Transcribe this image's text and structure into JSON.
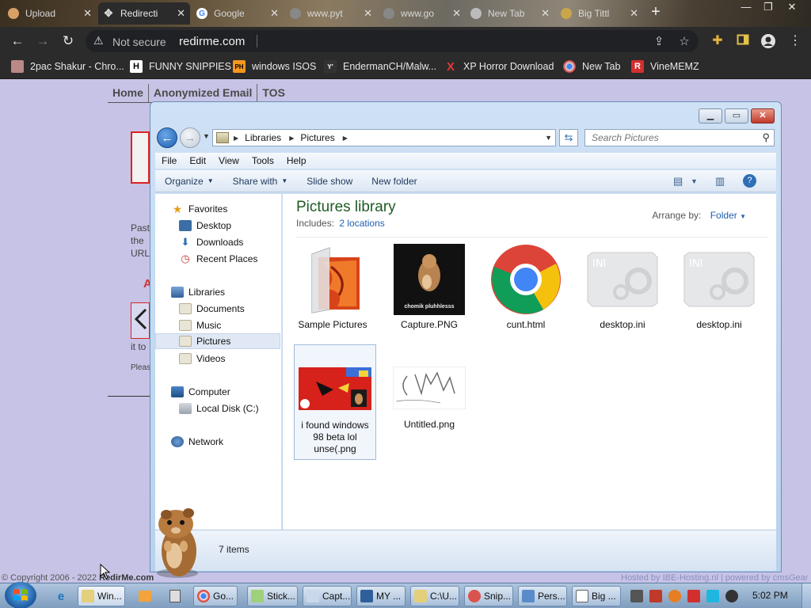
{
  "browser": {
    "tabs": [
      {
        "label": "Upload",
        "icon": "upload-tab-icon",
        "active": false
      },
      {
        "label": "Redirecti",
        "icon": "redirect-icon",
        "active": true
      },
      {
        "label": "Google",
        "icon": "google-icon",
        "active": false
      },
      {
        "label": "www.pyt",
        "icon": "globe-icon",
        "active": false
      },
      {
        "label": "www.go",
        "icon": "globe-icon",
        "active": false
      },
      {
        "label": "New Tab",
        "icon": "chrome-icon",
        "active": false
      },
      {
        "label": "Big Tittl",
        "icon": "page-icon",
        "active": false
      }
    ],
    "security_label": "Not secure",
    "url": "redirme.com",
    "bookmarks": [
      {
        "label": "2pac Shakur - Chro...",
        "icon": "bookmark-2pac-icon"
      },
      {
        "label": "FUNNY SNIPPIES",
        "icon": "h-icon"
      },
      {
        "label": "windows ISOS",
        "icon": "ph-icon"
      },
      {
        "label": "EndermanCH/Malw...",
        "icon": "yp-icon"
      },
      {
        "label": "XP Horror Download",
        "icon": "x-icon"
      },
      {
        "label": "New Tab",
        "icon": "chrome-icon"
      },
      {
        "label": "VineMEMZ",
        "icon": "r-icon"
      }
    ]
  },
  "webpage": {
    "nav": [
      "Home",
      "Anonymized Email",
      "TOS"
    ],
    "fragments": {
      "past": "Past",
      "the": "the",
      "url": "URL",
      "a": "A",
      "itto": "it to",
      "pleas": "Pleas"
    },
    "copyright_prefix": "© Copyright 2006 - 2022",
    "copyright_site": "RedirMe.com",
    "hosted": "Hosted by IBE-Hosting.nl  |  powered by cmsGear"
  },
  "explorer": {
    "breadcrumbs": [
      "Libraries",
      "Pictures"
    ],
    "search_placeholder": "Search Pictures",
    "menu": [
      "File",
      "Edit",
      "View",
      "Tools",
      "Help"
    ],
    "commands": [
      {
        "label": "Organize",
        "dropdown": true
      },
      {
        "label": "Share with",
        "dropdown": true
      },
      {
        "label": "Slide show",
        "dropdown": false
      },
      {
        "label": "New folder",
        "dropdown": false
      }
    ],
    "nav_pane": {
      "favorites_label": "Favorites",
      "favorites": [
        "Desktop",
        "Downloads",
        "Recent Places"
      ],
      "libraries_label": "Libraries",
      "libraries": [
        "Documents",
        "Music",
        "Pictures",
        "Videos"
      ],
      "selected": "Pictures",
      "computer_label": "Computer",
      "computer": [
        "Local Disk (C:)"
      ],
      "network_label": "Network"
    },
    "library_title": "Pictures library",
    "includes_label": "Includes:",
    "includes_link": "2 locations",
    "arrange_label": "Arrange by:",
    "arrange_value": "Folder",
    "files": [
      {
        "name": "Sample Pictures",
        "type": "folder"
      },
      {
        "name": "Capture.PNG",
        "type": "image-hamster",
        "caption": "chomik pluhhlesss"
      },
      {
        "name": "cunt.html",
        "type": "chrome-html"
      },
      {
        "name": "desktop.ini",
        "type": "ini"
      },
      {
        "name": "desktop.ini",
        "type": "ini"
      },
      {
        "name": "i found windows 98 beta lol unse(.png",
        "type": "image-red",
        "selected": true
      },
      {
        "name": "Untitled.png",
        "type": "image-sketch"
      }
    ],
    "item_count": "7 items"
  },
  "taskbar": {
    "tasks": [
      {
        "label": "Win...",
        "icon": "windows-explorer-icon",
        "active": true
      },
      {
        "label": "Go...",
        "icon": "chrome-icon"
      },
      {
        "label": "Stick...",
        "icon": "sticky-notes-icon"
      },
      {
        "label": "Capt...",
        "icon": "paint-icon"
      },
      {
        "label": "MY ...",
        "icon": "mail-icon"
      },
      {
        "label": "C:\\U...",
        "icon": "cmd-icon"
      },
      {
        "label": "Snip...",
        "icon": "snipping-tool-icon"
      },
      {
        "label": "Pers...",
        "icon": "personalize-icon"
      },
      {
        "label": "Big ...",
        "icon": "window-icon"
      }
    ],
    "clock": "5:02 PM"
  }
}
